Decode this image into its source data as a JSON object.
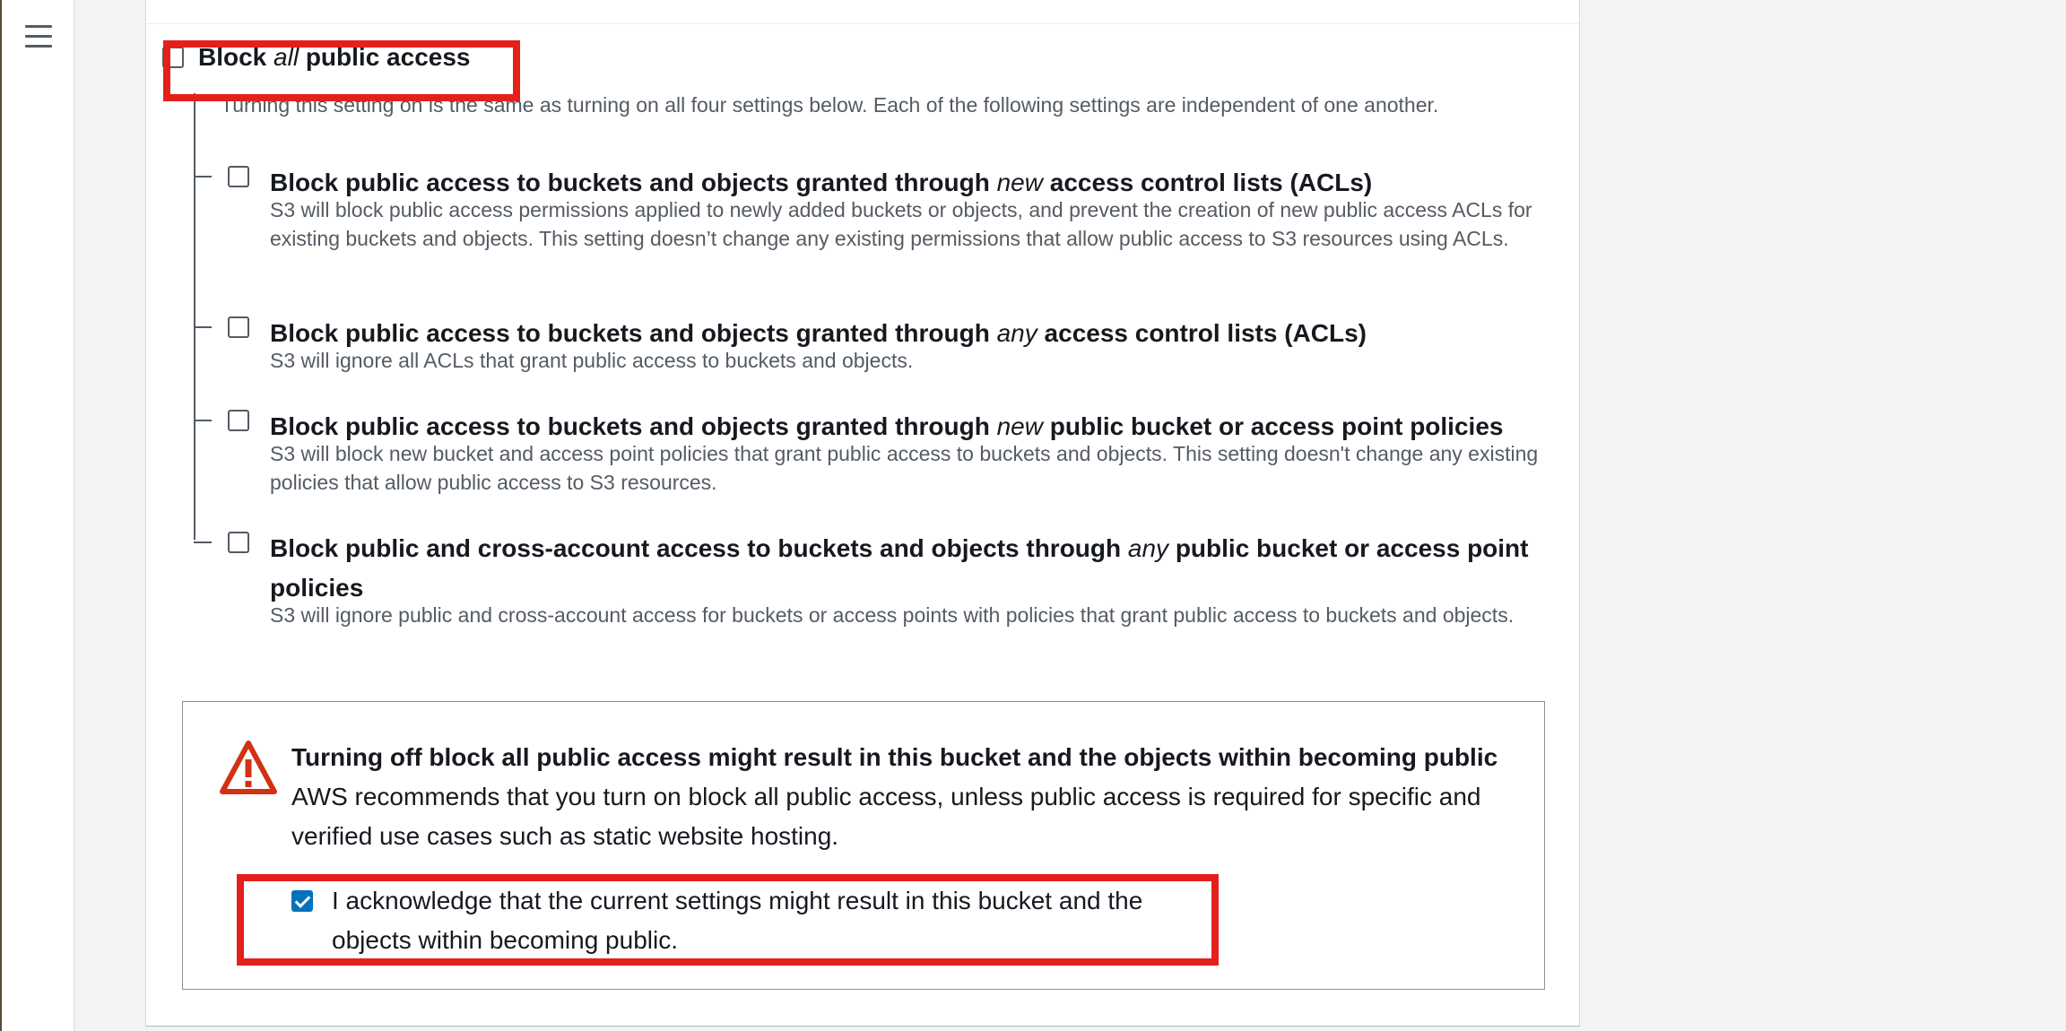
{
  "nav": {
    "menu_icon": "hamburger-menu-icon"
  },
  "block_all": {
    "label_prefix": "Block ",
    "label_emphasis": "all",
    "label_suffix": " public access",
    "checked": false,
    "description": "Turning this setting on is the same as turning on all four settings below. Each of the following settings are independent of one another."
  },
  "options": [
    {
      "title_prefix": "Block public access to buckets and objects granted through ",
      "title_emphasis": "new",
      "title_suffix": " access control lists (ACLs)",
      "description": "S3 will block public access permissions applied to newly added buckets or objects, and prevent the creation of new public access ACLs for existing buckets and objects. This setting doesn’t change any existing permissions that allow public access to S3 resources using ACLs.",
      "checked": false
    },
    {
      "title_prefix": "Block public access to buckets and objects granted through ",
      "title_emphasis": "any",
      "title_suffix": " access control lists (ACLs)",
      "description": "S3 will ignore all ACLs that grant public access to buckets and objects.",
      "checked": false
    },
    {
      "title_prefix": "Block public access to buckets and objects granted through ",
      "title_emphasis": "new",
      "title_suffix": " public bucket or access point policies",
      "description": "S3 will block new bucket and access point policies that grant public access to buckets and objects. This setting doesn't change any existing policies that allow public access to S3 resources.",
      "checked": false
    },
    {
      "title_prefix": "Block public and cross-account access to buckets and objects through ",
      "title_emphasis": "any",
      "title_suffix": " public bucket or access point policies",
      "description": "S3 will ignore public and cross-account access for buckets or access points with policies that grant public access to buckets and objects.",
      "checked": false
    }
  ],
  "warning": {
    "icon": "warning-triangle-icon",
    "title": "Turning off block all public access might result in this bucket and the objects within becoming public",
    "body": "AWS recommends that you turn on block all public access, unless public access is required for specific and verified use cases such as static website hosting.",
    "acknowledge_label": "I acknowledge that the current settings might result in this bucket and the objects within becoming public.",
    "acknowledge_checked": true
  },
  "colors": {
    "highlight": "#e3201b",
    "checkbox_checked": "#0073bb",
    "warning_icon": "#d13212",
    "secondary_text": "#545b64"
  }
}
